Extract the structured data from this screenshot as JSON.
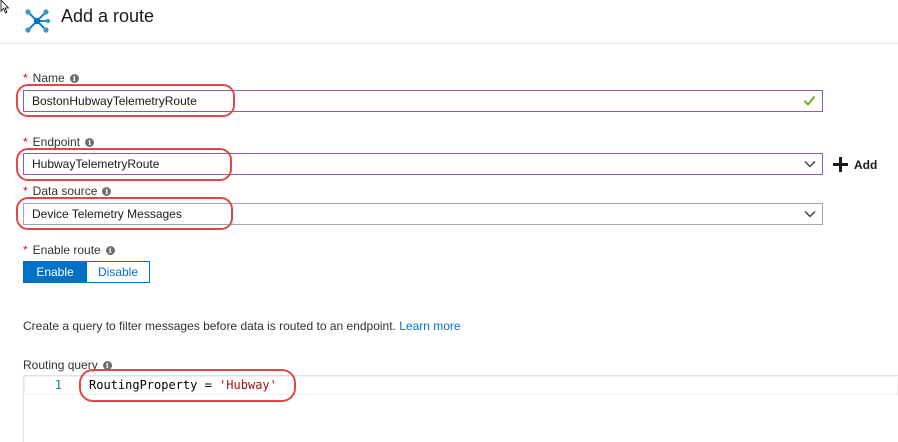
{
  "header": {
    "title": "Add a route",
    "icon": "route-icon"
  },
  "form": {
    "name": {
      "label": "Name",
      "value": "BostonHubwayTelemetryRoute",
      "required": true
    },
    "endpoint": {
      "label": "Endpoint",
      "value": "HubwayTelemetryRoute",
      "required": true,
      "add_label": "Add"
    },
    "data_source": {
      "label": "Data source",
      "value": "Device Telemetry Messages",
      "required": true
    },
    "enable_route": {
      "label": "Enable route",
      "required": true,
      "enable_label": "Enable",
      "disable_label": "Disable",
      "selected": "Enable"
    },
    "description": "Create a query to filter messages before data is routed to an endpoint.",
    "learn_more": "Learn more",
    "routing_query": {
      "label": "Routing query",
      "line_number": "1",
      "code_identifier": "RoutingProperty",
      "code_operator": "=",
      "code_string": "'Hubway'"
    }
  },
  "colors": {
    "accent": "#0072c6",
    "required": "#e00b1c",
    "callout": "#e04848",
    "valid": "#57a300",
    "focus_border": "#8a5bbd"
  }
}
